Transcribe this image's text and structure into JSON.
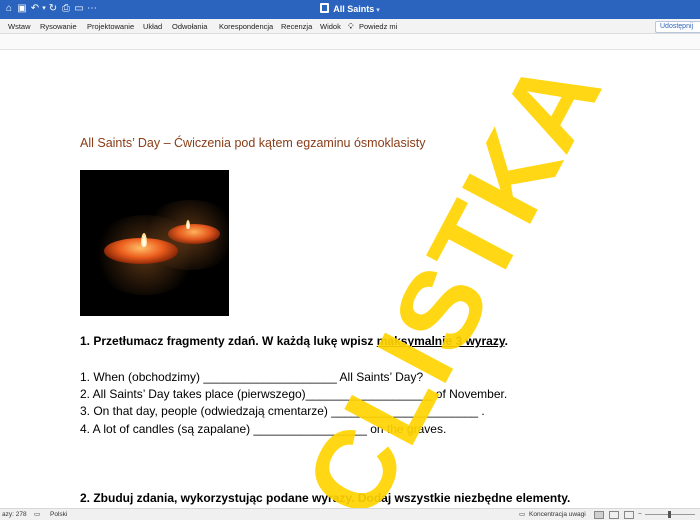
{
  "window": {
    "title": "All Saints"
  },
  "ribbon": {
    "tabs": [
      "Wstaw",
      "Rysowanie",
      "Projektowanie",
      "Układ",
      "Odwołania",
      "Korespondencja",
      "Recenzja",
      "Widok"
    ],
    "tell_me": "Powiedz mi",
    "share": "Udostępnij"
  },
  "document": {
    "heading": "All Saints’ Day – Ćwiczenia pod kątem egzaminu ósmoklasisty",
    "task1": {
      "title_start": "1. Przetłumacz fragmenty zdań. W każdą lukę wpisz ",
      "title_underlined": "maksymalnie 3 wyrazy",
      "title_end": ".",
      "items": [
        "1. When (obchodzimy) ____________________ All Saints’ Day?",
        "2. All Saints’ Day takes place (pierwszego)___________________ of November.",
        "3. On that day, people (odwiedzają cmentarze) ______________________ .",
        "4. A lot of candles (są zapalane) _________________ on the graves."
      ]
    },
    "task2": {
      "title": "2. Zbuduj zdania, wykorzystując podane wyrazy. Dodaj wszystkie niezbędne elementy."
    },
    "watermark": "CLISTKA"
  },
  "status": {
    "words": "azy: 278",
    "language": "Polski",
    "focus": "Koncentracja uwagi"
  },
  "colors": {
    "titlebar": "#2b64bf",
    "heading": "#8a3c17",
    "watermark": "#ffd400"
  }
}
